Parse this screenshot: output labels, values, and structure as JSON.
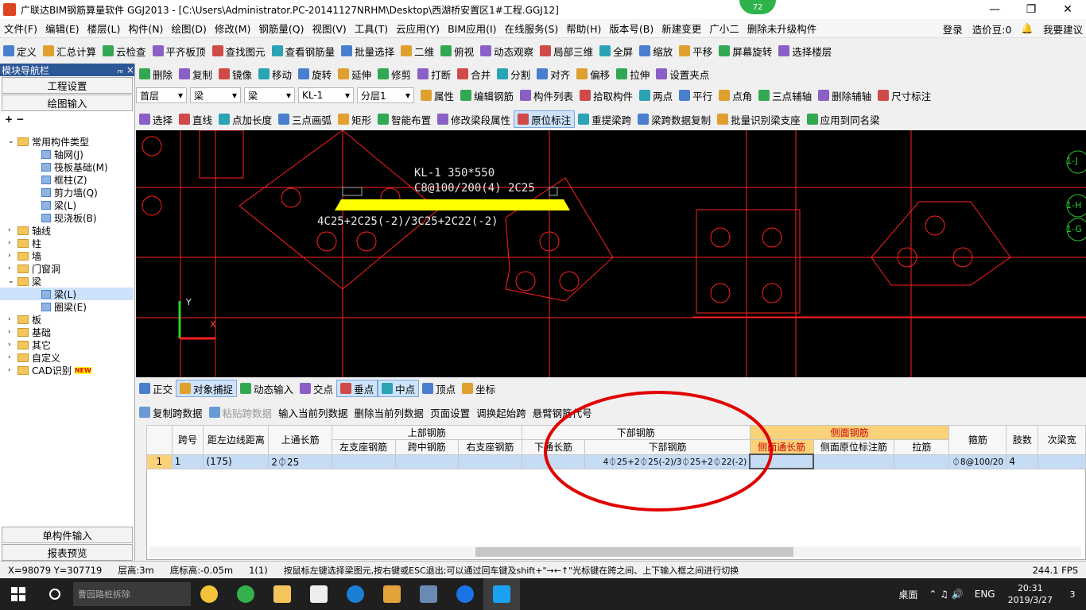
{
  "title": "广联达BIM钢筋算量软件 GGJ2013 - [C:\\Users\\Administrator.PC-20141127NRHM\\Desktop\\西湖桥安置区1#工程.GGJ12]",
  "badge": "72",
  "menu": [
    "文件(F)",
    "编辑(E)",
    "楼层(L)",
    "构件(N)",
    "绘图(D)",
    "修改(M)",
    "钢筋量(Q)",
    "视图(V)",
    "工具(T)",
    "云应用(Y)",
    "BIM应用(I)",
    "在线服务(S)",
    "帮助(H)",
    "版本号(B)",
    "新建变更",
    "广小二",
    "删除未升级构件"
  ],
  "menu_right": {
    "login": "登录",
    "cost": "造价豆:0",
    "suggest": "我要建议"
  },
  "toolbar1": [
    "定义",
    "汇总计算",
    "云检查",
    "平齐板顶",
    "查找图元",
    "查看钢筋量",
    "批量选择",
    "二维",
    "俯视",
    "动态观察",
    "局部三维",
    "全屏",
    "缩放",
    "平移",
    "屏幕旋转",
    "选择楼层"
  ],
  "toolbar2": [
    "删除",
    "复制",
    "镜像",
    "移动",
    "旋转",
    "延伸",
    "修剪",
    "打断",
    "合并",
    "分割",
    "对齐",
    "偏移",
    "拉伸",
    "设置夹点"
  ],
  "toolbar3": {
    "floor": "首层",
    "type1": "梁",
    "type2": "梁",
    "comp": "KL-1",
    "layer": "分层1",
    "items": [
      "属性",
      "编辑钢筋",
      "构件列表",
      "拾取构件",
      "两点",
      "平行",
      "点角",
      "三点辅轴",
      "删除辅轴",
      "尺寸标注"
    ]
  },
  "toolbar4": [
    "选择",
    "直线",
    "点加长度",
    "三点画弧",
    "矩形",
    "智能布置",
    "修改梁段属性",
    "原位标注",
    "重提梁跨",
    "梁跨数据复制",
    "批量识别梁支座",
    "应用到同名梁"
  ],
  "nav": {
    "header": "模块导航栏",
    "pin": "ₘ ×",
    "btn1": "工程设置",
    "btn2": "绘图输入",
    "btn3": "单构件输入",
    "btn4": "报表预览"
  },
  "tree": [
    {
      "label": "常用构件类型",
      "level": 0,
      "open": true
    },
    {
      "label": "轴网(J)",
      "level": 1
    },
    {
      "label": "筏板基础(M)",
      "level": 1
    },
    {
      "label": "框柱(Z)",
      "level": 1
    },
    {
      "label": "剪力墙(Q)",
      "level": 1
    },
    {
      "label": "梁(L)",
      "level": 1
    },
    {
      "label": "现浇板(B)",
      "level": 1
    },
    {
      "label": "轴线",
      "level": 0
    },
    {
      "label": "柱",
      "level": 0
    },
    {
      "label": "墙",
      "level": 0
    },
    {
      "label": "门窗洞",
      "level": 0
    },
    {
      "label": "梁",
      "level": 0,
      "open": true
    },
    {
      "label": "梁(L)",
      "level": 1,
      "selected": true
    },
    {
      "label": "圈梁(E)",
      "level": 1
    },
    {
      "label": "板",
      "level": 0
    },
    {
      "label": "基础",
      "level": 0
    },
    {
      "label": "其它",
      "level": 0
    },
    {
      "label": "自定义",
      "level": 0
    },
    {
      "label": "CAD识别",
      "level": 0,
      "new": "NEW"
    }
  ],
  "cad": {
    "beam_name": "KL-1 350*550",
    "stirrup": "C8@100/200(4) 2C25",
    "bottom": "4C25+2C25(-2)/3C25+2C22(-2)",
    "axis_y": "Y",
    "axis_x": "X",
    "axis_labels": [
      "1-J",
      "1-H",
      "1-G"
    ]
  },
  "snap": [
    "正交",
    "对象捕捉",
    "动态输入",
    "交点",
    "垂点",
    "中点",
    "顶点",
    "坐标"
  ],
  "gridtools": [
    "复制跨数据",
    "粘贴跨数据",
    "输入当前列数据",
    "删除当前列数据",
    "页面设置",
    "调换起始跨",
    "悬臂钢筋代号"
  ],
  "grid": {
    "h_top": [
      "跨号",
      "上通长筋",
      "上部钢筋",
      "下部钢筋",
      "侧面钢筋",
      "箍筋",
      "肢数",
      "次梁宽"
    ],
    "h_sub": [
      "距左边线距离",
      "左支座钢筋",
      "跨中钢筋",
      "右支座钢筋",
      "下通长筋",
      "下部钢筋",
      "侧面通长筋",
      "侧面原位标注筋",
      "拉筋"
    ],
    "row": {
      "idx": "1",
      "span": "1",
      "dist": "(175)",
      "top": "2⏀25",
      "bottom": "4⏀25+2⏀25(-2)/3⏀25+2⏀22(-2)",
      "stirrup": "⏀8@100/20",
      "legs": "4"
    }
  },
  "status": {
    "coord": "X=98079 Y=307719",
    "floor_h": "层高:3m",
    "base": "底标高:-0.05m",
    "sel": "1(1)",
    "hint": "按鼠标左键选择梁图元,按右键或ESC退出;可以通过回车键及shift+\"→←↑\"光标键在跨之间、上下输入框之间进行切换",
    "fps": "244.1 FPS"
  },
  "taskbar": {
    "search": "曹园路桩拆除",
    "desktop": "桌面",
    "lang": "ENG",
    "time": "20:31",
    "date": "2019/3/27",
    "notif": "3"
  },
  "colors": {
    "beam": "#ffff00",
    "cad_line": "#ff2020",
    "cad_text": "#e8e8e8",
    "highlight_circle": "#e00000",
    "row_sel": "#c6dcf5"
  }
}
